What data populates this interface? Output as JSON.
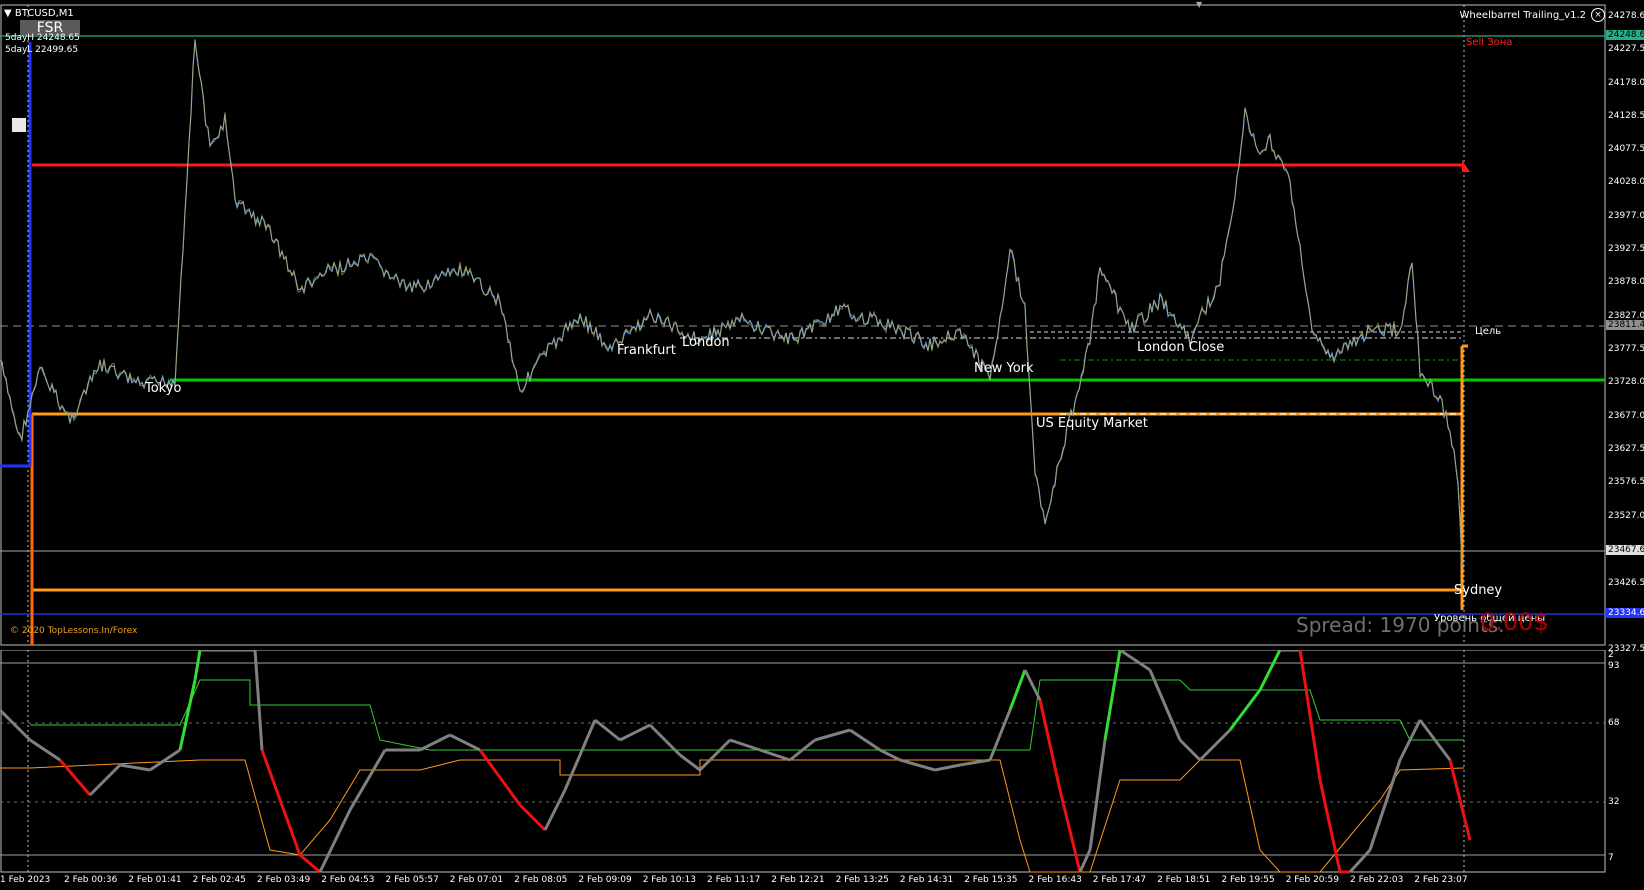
{
  "chart_header": {
    "symbol_label": "BTCUSD,M1",
    "fsr_button": "FSR",
    "day_high": "5dayH 24248.65",
    "day_low": "5dayL 22499.65",
    "indicator_name": "Wheelbarrel Trailing_v1.2",
    "copyright": "© 2020 TopLessons.In/Forex"
  },
  "overlays": {
    "spread": "Spread: 1970 points.",
    "money": "0.00$",
    "sell_zone": "Sell Зона",
    "target": "Цель",
    "common_price_level": "Уровень общей цены"
  },
  "sessions": [
    {
      "label": "Tokyo"
    },
    {
      "label": "Frankfurt"
    },
    {
      "label": "London"
    },
    {
      "label": "New York"
    },
    {
      "label": "London Close"
    },
    {
      "label": "US Equity Market"
    },
    {
      "label": "Sydney"
    }
  ],
  "price_axis": [
    "24278.6",
    "24227.5",
    "24178.0",
    "24128.5",
    "24077.5",
    "24028.0",
    "23977.0",
    "23927.5",
    "23878.0",
    "23827.0",
    "23777.5",
    "23728.0",
    "23677.0",
    "23627.5",
    "23576.5",
    "23527.0",
    "23426.5",
    "23327.5"
  ],
  "price_tags": {
    "high": "24248.6",
    "target": "23811.4",
    "current": "23467.6",
    "blue": "23334.6"
  },
  "indicator_axis": [
    "2",
    "93",
    "68",
    "32",
    "7"
  ],
  "time_axis": [
    "1 Feb 2023",
    "2 Feb 00:36",
    "2 Feb 01:41",
    "2 Feb 02:45",
    "2 Feb 03:49",
    "2 Feb 04:53",
    "2 Feb 05:57",
    "2 Feb 07:01",
    "2 Feb 08:05",
    "2 Feb 09:09",
    "2 Feb 10:13",
    "2 Feb 11:17",
    "2 Feb 12:21",
    "2 Feb 13:25",
    "2 Feb 14:31",
    "2 Feb 15:35",
    "2 Feb 16:43",
    "2 Feb 17:47",
    "2 Feb 18:51",
    "2 Feb 19:55",
    "2 Feb 20:59",
    "2 Feb 22:03",
    "2 Feb 23:07"
  ],
  "colors": {
    "background": "#000000",
    "price_line": "#6aa0d8",
    "price_line_alt": "#b8a850",
    "resistance": "#ff1a1a",
    "support": "#00c800",
    "orange": "#ff9a1a",
    "bull": "#33dd33",
    "bear": "#ee1111",
    "oscillator": "#808080"
  }
}
